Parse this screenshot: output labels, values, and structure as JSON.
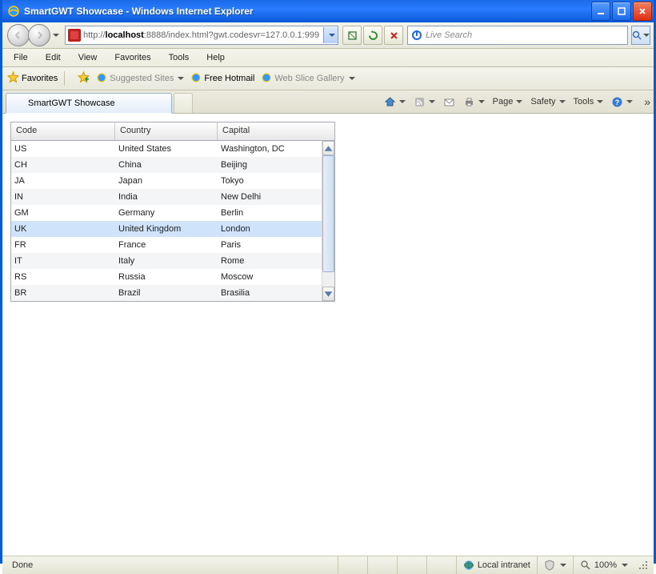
{
  "window": {
    "title": "SmartGWT Showcase - Windows Internet Explorer"
  },
  "address": {
    "scheme": "http://",
    "host": "localhost",
    "rest": ":8888/index.html?gwt.codesvr=127.0.0.1:999"
  },
  "search": {
    "placeholder": "Live Search"
  },
  "menu": {
    "items": [
      "File",
      "Edit",
      "View",
      "Favorites",
      "Tools",
      "Help"
    ]
  },
  "favbar": {
    "favorites": "Favorites",
    "suggested": "Suggested Sites",
    "hotmail": "Free Hotmail",
    "webslice": "Web Slice Gallery"
  },
  "tab": {
    "title": "SmartGWT Showcase"
  },
  "commandbar": {
    "page": "Page",
    "safety": "Safety",
    "tools": "Tools"
  },
  "grid": {
    "headers": {
      "code": "Code",
      "country": "Country",
      "capital": "Capital"
    },
    "selected_index": 5,
    "rows": [
      {
        "code": "US",
        "country": "United States",
        "capital": "Washington, DC"
      },
      {
        "code": "CH",
        "country": "China",
        "capital": "Beijing"
      },
      {
        "code": "JA",
        "country": "Japan",
        "capital": "Tokyo"
      },
      {
        "code": "IN",
        "country": "India",
        "capital": "New Delhi"
      },
      {
        "code": "GM",
        "country": "Germany",
        "capital": "Berlin"
      },
      {
        "code": "UK",
        "country": "United Kingdom",
        "capital": "London"
      },
      {
        "code": "FR",
        "country": "France",
        "capital": "Paris"
      },
      {
        "code": "IT",
        "country": "Italy",
        "capital": "Rome"
      },
      {
        "code": "RS",
        "country": "Russia",
        "capital": "Moscow"
      },
      {
        "code": "BR",
        "country": "Brazil",
        "capital": "Brasilia"
      }
    ]
  },
  "status": {
    "done": "Done",
    "zone": "Local intranet",
    "zoom": "100%"
  }
}
